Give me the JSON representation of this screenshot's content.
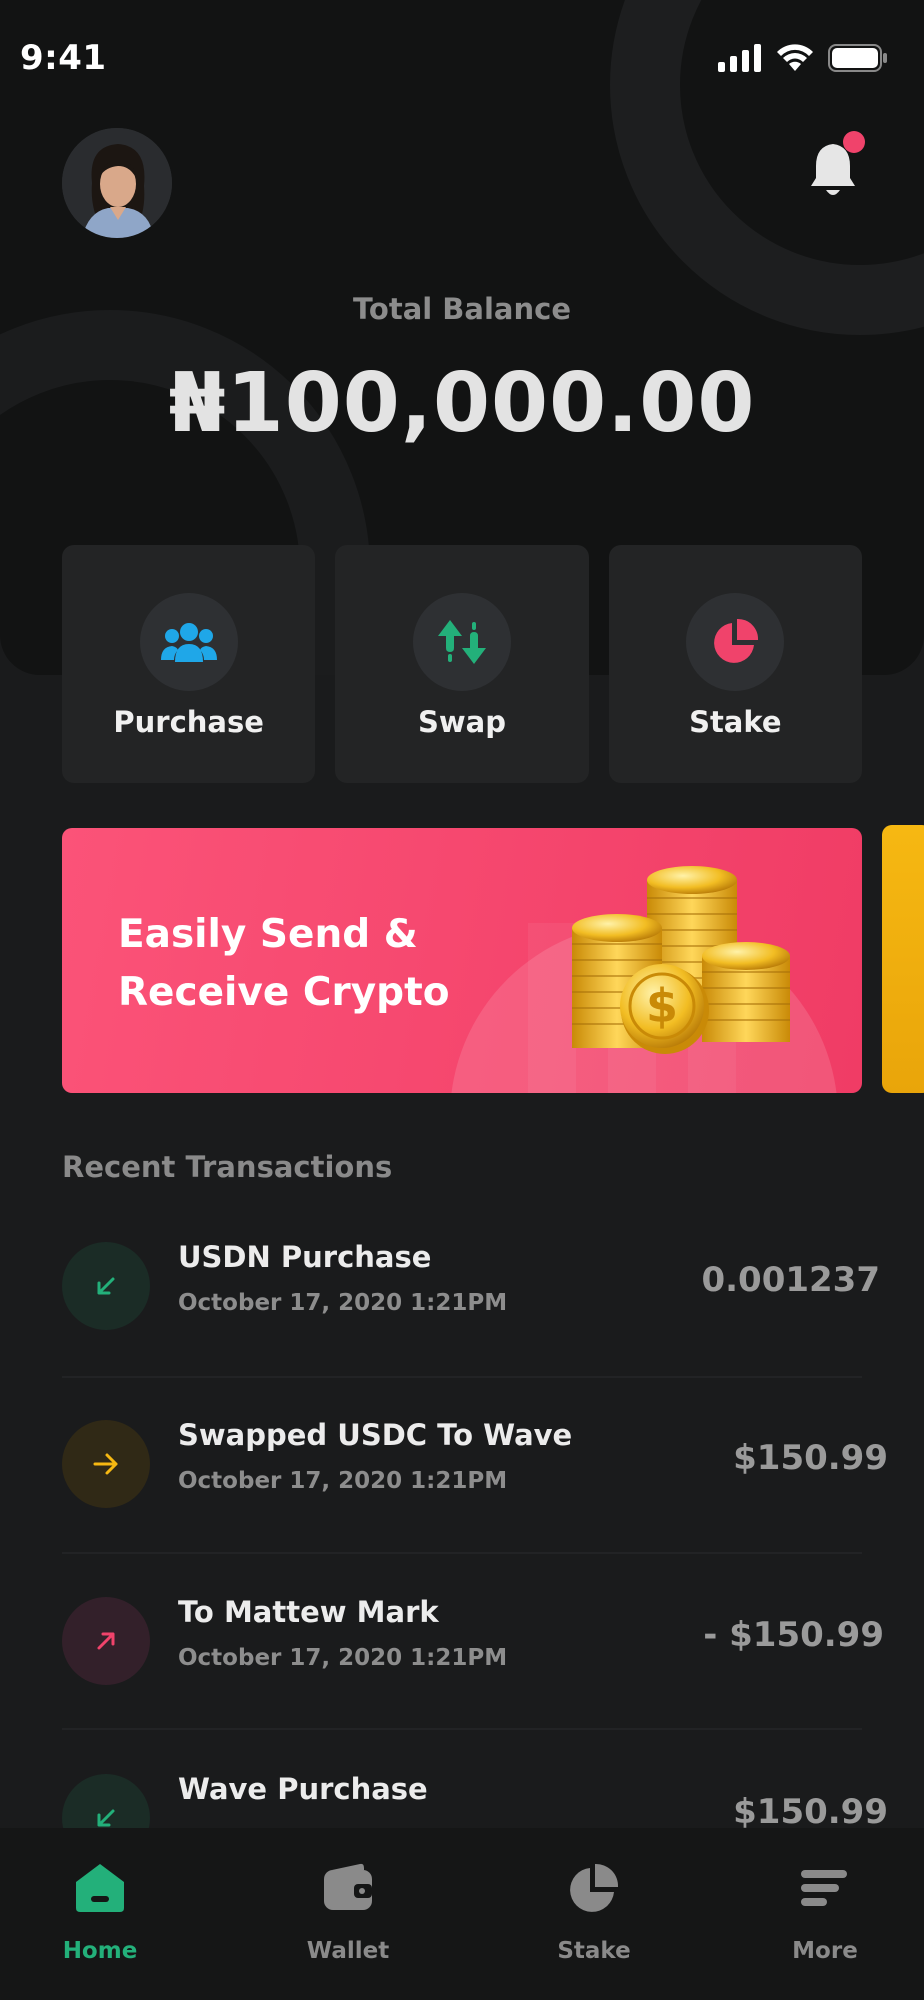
{
  "status_bar": {
    "time": "9:41"
  },
  "header": {
    "notification_badge": true
  },
  "balance": {
    "label": "Total Balance",
    "value": "₦100,000.00"
  },
  "actions": [
    {
      "label": "Purchase",
      "icon": "users-icon",
      "color": "#1fa7e8"
    },
    {
      "label": "Swap",
      "icon": "swap-arrows-icon",
      "color": "#23b07a"
    },
    {
      "label": "Stake",
      "icon": "pie-chart-icon",
      "color": "#f0436b"
    }
  ],
  "banner": {
    "title": "Easily Send & Receive Crypto",
    "image": "gold-coins-illustration",
    "color": "#f03c65"
  },
  "recent": {
    "title": "Recent Transactions",
    "items": [
      {
        "title": "USDN Purchase",
        "date": "October 17, 2020 1:21PM",
        "amount": "0.001237",
        "icon": "arrow-down-left-icon",
        "color": "#23b07a"
      },
      {
        "title": "Swapped USDC To Wave",
        "date": "October 17, 2020 1:21PM",
        "amount": "$150.99",
        "icon": "arrow-right-icon",
        "color": "#f6b812"
      },
      {
        "title": "To Mattew Mark",
        "date": "October 17, 2020 1:21PM",
        "amount": "- $150.99",
        "icon": "arrow-up-right-icon",
        "color": "#f0436b"
      },
      {
        "title": "Wave Purchase",
        "date": "",
        "amount": "$150.99",
        "icon": "arrow-down-left-icon",
        "color": "#23b07a"
      }
    ]
  },
  "tabbar": {
    "tabs": [
      {
        "label": "Home",
        "icon": "home-icon",
        "active": true
      },
      {
        "label": "Wallet",
        "icon": "wallet-icon",
        "active": false
      },
      {
        "label": "Stake",
        "icon": "pie-chart-icon",
        "active": false
      },
      {
        "label": "More",
        "icon": "menu-icon",
        "active": false
      }
    ],
    "active_color": "#23b07a"
  }
}
